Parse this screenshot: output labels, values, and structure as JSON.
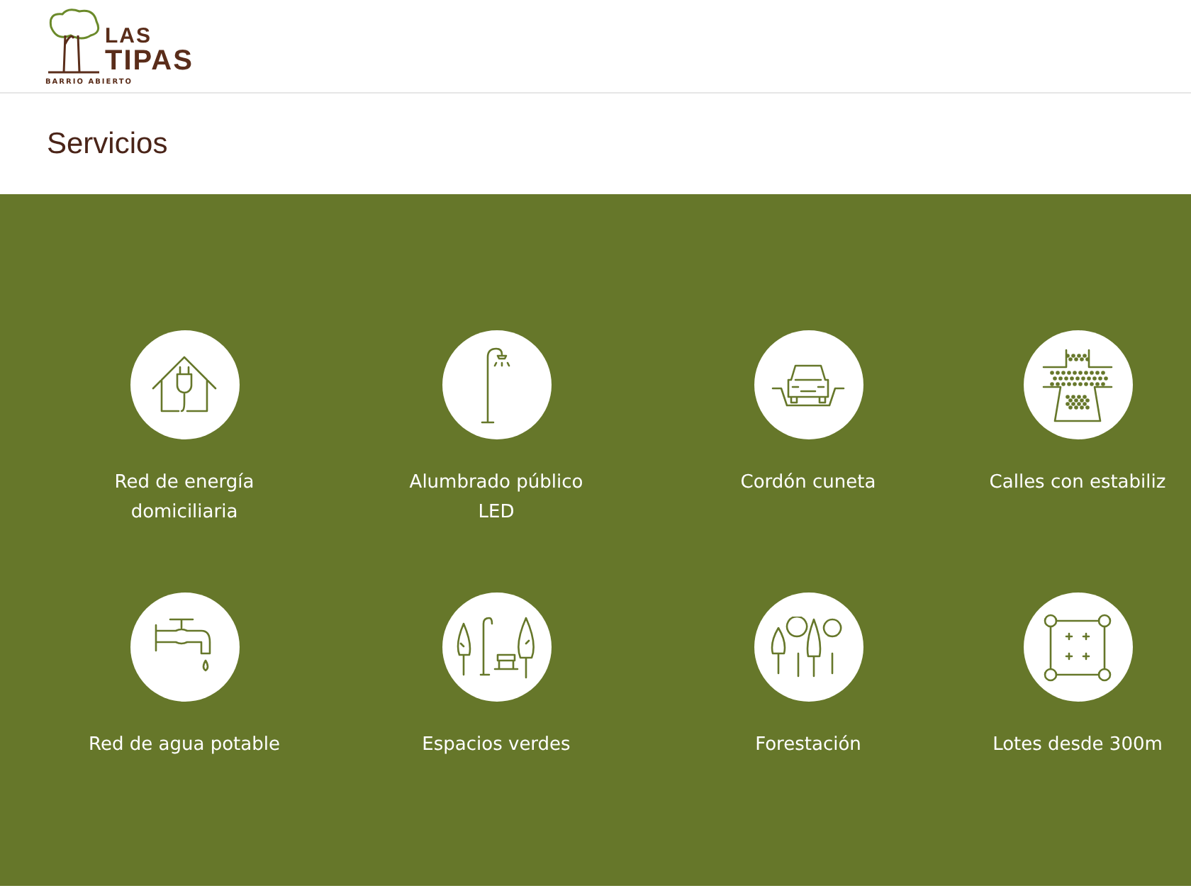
{
  "header": {
    "logo": {
      "line_1": "LAS",
      "line_2": "TIPAS",
      "tagline": "BARRIO ABIERTO"
    }
  },
  "section": {
    "title": "Servicios"
  },
  "services": [
    {
      "kind": "power",
      "label": "Red de energía domiciliaria"
    },
    {
      "kind": "streetlight",
      "label": "Alumbrado público LED"
    },
    {
      "kind": "curb",
      "label": "Cordón cuneta"
    },
    {
      "kind": "road",
      "label": "Calles con estabiliz"
    },
    {
      "kind": "water",
      "label": "Red de agua potable"
    },
    {
      "kind": "park",
      "label": "Espacios verdes"
    },
    {
      "kind": "trees",
      "label": "Forestación"
    },
    {
      "kind": "lot",
      "label": "Lotes desde 300m"
    }
  ]
}
